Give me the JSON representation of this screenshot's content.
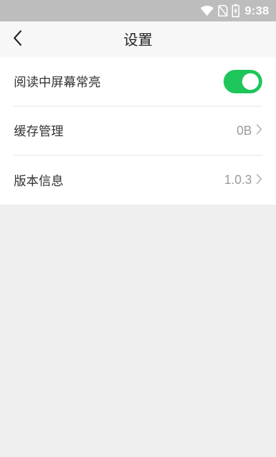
{
  "status_bar": {
    "time": "9:38",
    "icons": [
      "wifi-icon",
      "no-sim-icon",
      "battery-charging-icon"
    ]
  },
  "header": {
    "title": "设置",
    "back_icon": "chevron-left-icon"
  },
  "settings": {
    "keep_screen_on": {
      "label": "阅读中屏幕常亮",
      "enabled": true,
      "toggle_color": "#1ec55b"
    },
    "cache": {
      "label": "缓存管理",
      "value": "0B"
    },
    "version": {
      "label": "版本信息",
      "value": "1.0.3"
    }
  },
  "colors": {
    "status_bar_bg": "#bdbdbd",
    "title_bar_bg": "#f7f7f7",
    "page_bg": "#efefef",
    "list_bg": "#ffffff"
  }
}
